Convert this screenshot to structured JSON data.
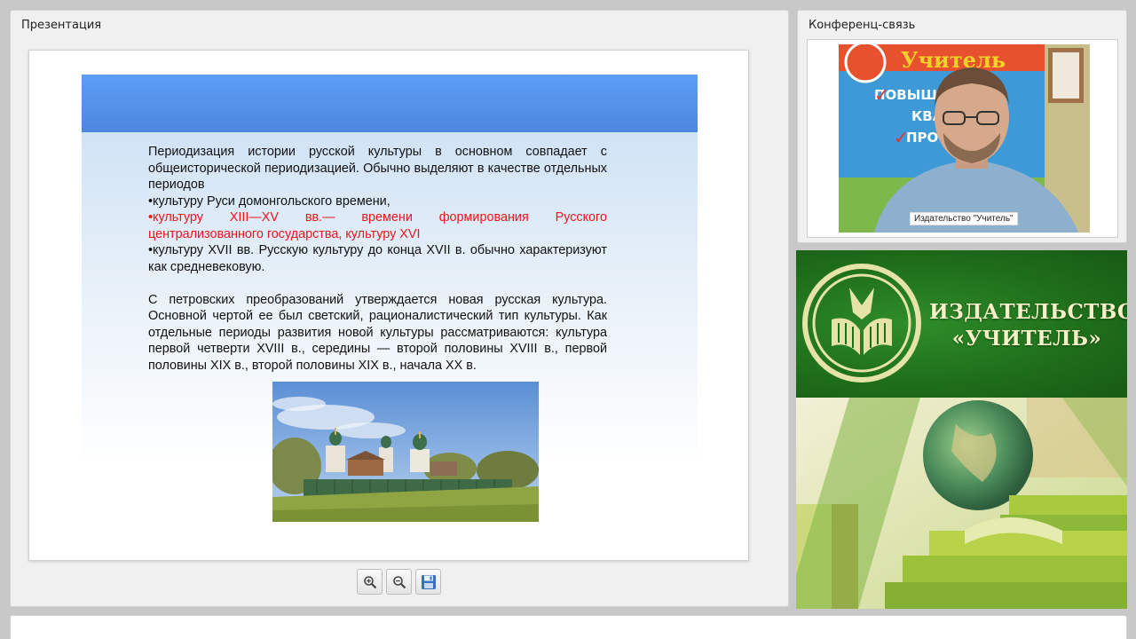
{
  "presentation": {
    "title": "Презентация",
    "slide": {
      "lines": [
        {
          "text": "Периодизация истории русской культуры в основном совпадает с общеисторической периодизацией. Обычно выделяют в качестве отдельных периодов",
          "red": false
        },
        {
          "text": "•культуру Руси домонгольского времени,",
          "red": false
        },
        {
          "text": "•культуру XIII—XV вв.— времени формирования Русского централизованного государства, культуру XVI",
          "red": true
        },
        {
          "text": "•культуру XVII вв. Русскую культуру до конца XVII в. обычно характеризуют как средневековую.",
          "red": false
        },
        {
          "text": "С петровских преобразований утверждается новая русская культура. Основной чертой ее был светский, рационалистический тип культуры. Как отдельные периоды развития новой культуры рассматриваются: культура первой четверти XVIII в., середины — второй половины XVIII в., первой половины XIX в., второй половины XIX в., начала XX в.",
          "red": false
        }
      ],
      "accent_color": "#e8161f",
      "header_color": "#5a98f0"
    },
    "toolbar": {
      "zoom_in_icon": "zoom-in-icon",
      "zoom_out_icon": "zoom-out-icon",
      "save_icon": "floppy-disk-icon"
    }
  },
  "conference": {
    "title": "Конференц-связь",
    "video_caption": "Издательство \"Учитель\"",
    "poster": {
      "brand": "Учитель",
      "lines": [
        "ПОВЫШ",
        "КВА",
        "ПРОФ"
      ]
    }
  },
  "banner": {
    "name_line1": "ИЗДАТЕЛЬСТВО",
    "name_line2": "«УЧИТЕЛЬ»",
    "color": "#1f6f1b"
  }
}
